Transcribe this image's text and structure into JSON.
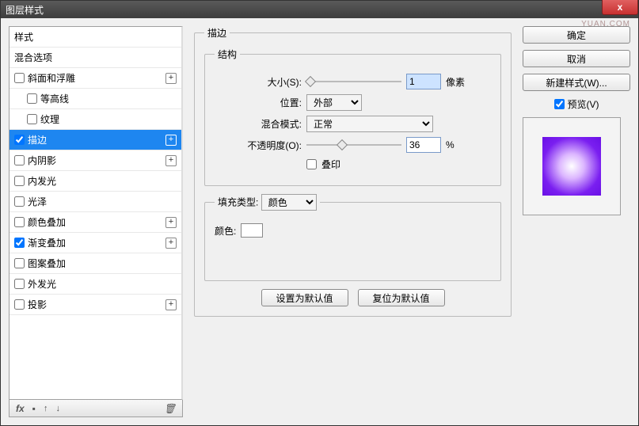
{
  "window": {
    "title": "图层样式",
    "watermark": "YUAN.COM",
    "close_x": "x"
  },
  "styles_panel": {
    "header1": "样式",
    "header2": "混合选项",
    "items": [
      {
        "label": "斜面和浮雕",
        "checked": false,
        "plus": true,
        "sub": false
      },
      {
        "label": "等高线",
        "checked": false,
        "plus": false,
        "sub": true
      },
      {
        "label": "纹理",
        "checked": false,
        "plus": false,
        "sub": true
      },
      {
        "label": "描边",
        "checked": true,
        "plus": true,
        "sub": false,
        "selected": true
      },
      {
        "label": "内阴影",
        "checked": false,
        "plus": true,
        "sub": false
      },
      {
        "label": "内发光",
        "checked": false,
        "plus": false,
        "sub": false
      },
      {
        "label": "光泽",
        "checked": false,
        "plus": false,
        "sub": false
      },
      {
        "label": "颜色叠加",
        "checked": false,
        "plus": true,
        "sub": false
      },
      {
        "label": "渐变叠加",
        "checked": true,
        "plus": true,
        "sub": false
      },
      {
        "label": "图案叠加",
        "checked": false,
        "plus": false,
        "sub": false
      },
      {
        "label": "外发光",
        "checked": false,
        "plus": false,
        "sub": false
      },
      {
        "label": "投影",
        "checked": false,
        "plus": true,
        "sub": false
      }
    ],
    "footer": {
      "fx": "fx",
      "dot": "▪",
      "up": "↑",
      "down": "↓",
      "trash": "🗑"
    }
  },
  "center": {
    "group_title": "描边",
    "struct_title": "结构",
    "size_label": "大小(S):",
    "size_value": "1",
    "size_unit": "像素",
    "position_label": "位置:",
    "position_value": "外部",
    "blend_label": "混合模式:",
    "blend_value": "正常",
    "opacity_label": "不透明度(O):",
    "opacity_value": "36",
    "opacity_unit": "%",
    "overprint_label": "叠印",
    "fill_title": "",
    "filltype_label": "填充类型:",
    "filltype_value": "颜色",
    "color_label": "颜色:",
    "default_btn": "设置为默认值",
    "reset_btn": "复位为默认值"
  },
  "right": {
    "ok": "确定",
    "cancel": "取消",
    "new_style": "新建样式(W)...",
    "preview_label": "预览(V)",
    "preview_checked": true
  }
}
